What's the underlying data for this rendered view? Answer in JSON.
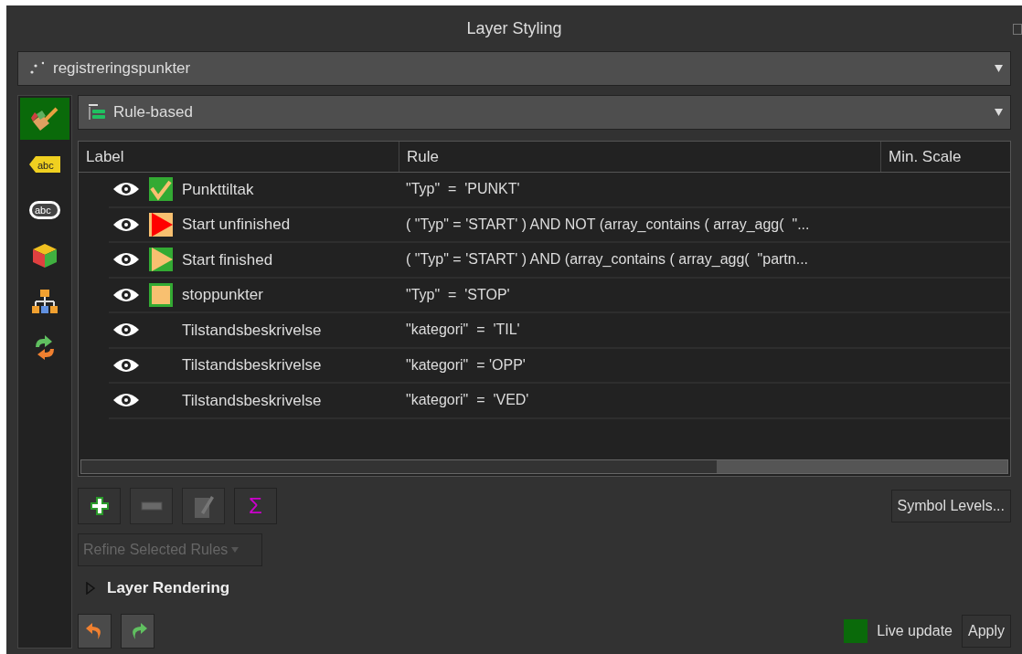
{
  "window": {
    "title": "Layer Styling"
  },
  "layer_select": {
    "value": "registreringspunkter"
  },
  "renderer_select": {
    "value": "Rule-based"
  },
  "sidebar": {
    "items": [
      {
        "kind": "brush",
        "selected": true
      },
      {
        "kind": "label",
        "text": "abc",
        "selected": false
      },
      {
        "kind": "mask",
        "text": "abc",
        "selected": false
      },
      {
        "kind": "cube",
        "selected": false
      },
      {
        "kind": "diagram",
        "selected": false
      },
      {
        "kind": "history",
        "selected": false
      }
    ]
  },
  "table": {
    "columns": [
      "Label",
      "Rule",
      "Min. Scale"
    ],
    "rows": [
      {
        "visible": true,
        "kind": "check",
        "label": "Punkttiltak",
        "rule": "\"Typ\"  =  'PUNKT'"
      },
      {
        "visible": true,
        "kind": "red-triangle",
        "label": "Start unfinished",
        "rule": "( \"Typ\" = 'START' ) AND NOT (array_contains ( array_agg(  \"..."
      },
      {
        "visible": true,
        "kind": "orange-triangle",
        "label": "Start finished",
        "rule": "( \"Typ\" = 'START' ) AND (array_contains ( array_agg(  \"partn..."
      },
      {
        "visible": true,
        "kind": "square",
        "label": "stoppunkter",
        "rule": "\"Typ\"  =  'STOP'"
      },
      {
        "visible": true,
        "kind": "none",
        "label": "Tilstandsbeskrivelse",
        "rule": "\"kategori\"  =  'TIL'"
      },
      {
        "visible": true,
        "kind": "none",
        "label": "Tilstandsbeskrivelse",
        "rule": "\"kategori\"  = 'OPP'"
      },
      {
        "visible": true,
        "kind": "none",
        "label": "Tilstandsbeskrivelse",
        "rule": "\"kategori\"  =  'VED'"
      }
    ]
  },
  "tools": [
    {
      "kind": "add",
      "disabled": false
    },
    {
      "kind": "remove",
      "disabled": true
    },
    {
      "kind": "edit",
      "disabled": true
    },
    {
      "kind": "sum",
      "text": "Σ",
      "disabled": false
    }
  ],
  "symbol_levels_button": "Symbol Levels...",
  "refine_button": {
    "label": "Refine Selected Rules",
    "disabled": true
  },
  "layer_rendering": {
    "title": "Layer Rendering",
    "expanded": false
  },
  "history": [
    {
      "kind": "undo"
    },
    {
      "kind": "redo"
    }
  ],
  "live_update": {
    "label": "Live update",
    "checked": true
  },
  "apply_button": "Apply"
}
